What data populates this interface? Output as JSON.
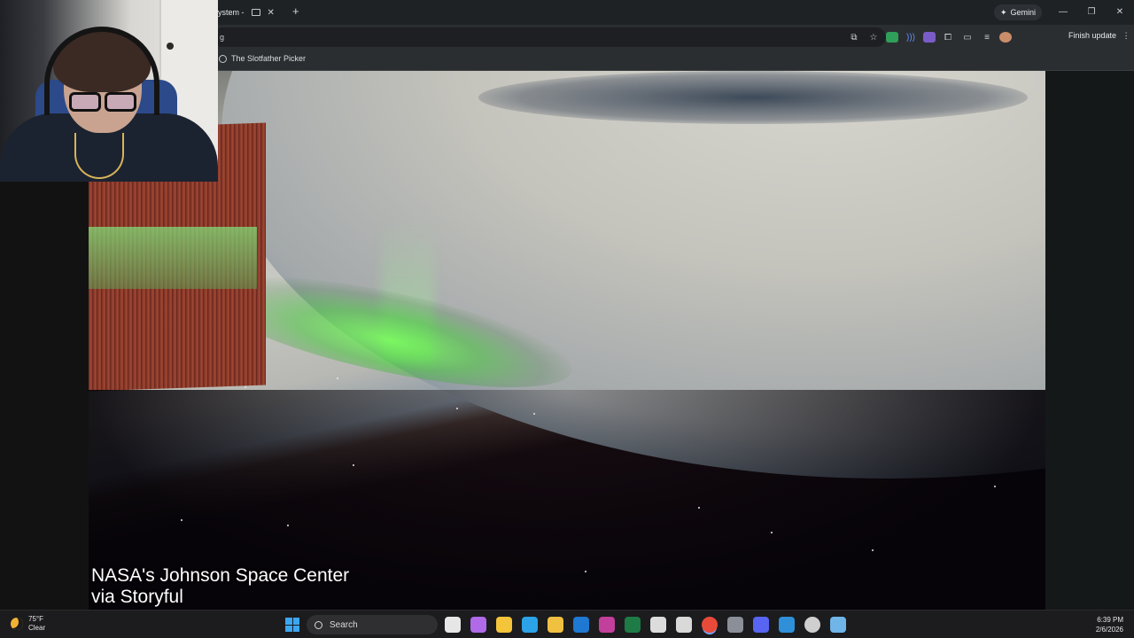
{
  "browser": {
    "tab_title": "System -",
    "tab_close": "✕",
    "new_tab": "+",
    "gemini_label": "Gemini",
    "gemini_icon": "✦",
    "omnibox_value": "g",
    "finish_update_label": "Finish update",
    "menu_icon": "⋮",
    "bookmark_label": "The Slotfather Picker",
    "window_controls": {
      "minimize": "—",
      "restore": "❐",
      "close": "✕"
    }
  },
  "video": {
    "caption_line1": "NASA's Johnson Space Center",
    "caption_line2": "via Storyful"
  },
  "taskbar": {
    "temperature": "75°F",
    "condition": "Clear",
    "search_label": "Search",
    "time": "6:39 PM",
    "date": "2/6/2026",
    "apps": [
      {
        "name": "file-explorer-icon",
        "color": "#e6e6e6"
      },
      {
        "name": "copilot-icon",
        "color": "#b06ae8"
      },
      {
        "name": "folder-icon",
        "color": "#f4c43a"
      },
      {
        "name": "edge-icon",
        "color": "#2ca3e8"
      },
      {
        "name": "store-icon",
        "color": "#f0c040"
      },
      {
        "name": "outlook-icon",
        "color": "#1f78d1"
      },
      {
        "name": "app-pink-icon",
        "color": "#c23f9b"
      },
      {
        "name": "excel-icon",
        "color": "#1e7b45"
      },
      {
        "name": "app-g-icon",
        "color": "#dcdcdc"
      },
      {
        "name": "ccleaner-icon",
        "color": "#d9d9d9"
      },
      {
        "name": "chrome-icon",
        "color": "#e84a3a"
      },
      {
        "name": "settings-icon",
        "color": "#8a8f98"
      },
      {
        "name": "discord-icon",
        "color": "#5865f2"
      },
      {
        "name": "app-blue-icon",
        "color": "#2f8fd8"
      },
      {
        "name": "app-circle-icon",
        "color": "#cfcfcf"
      },
      {
        "name": "steam-icon",
        "color": "#6fb5e8"
      }
    ]
  }
}
